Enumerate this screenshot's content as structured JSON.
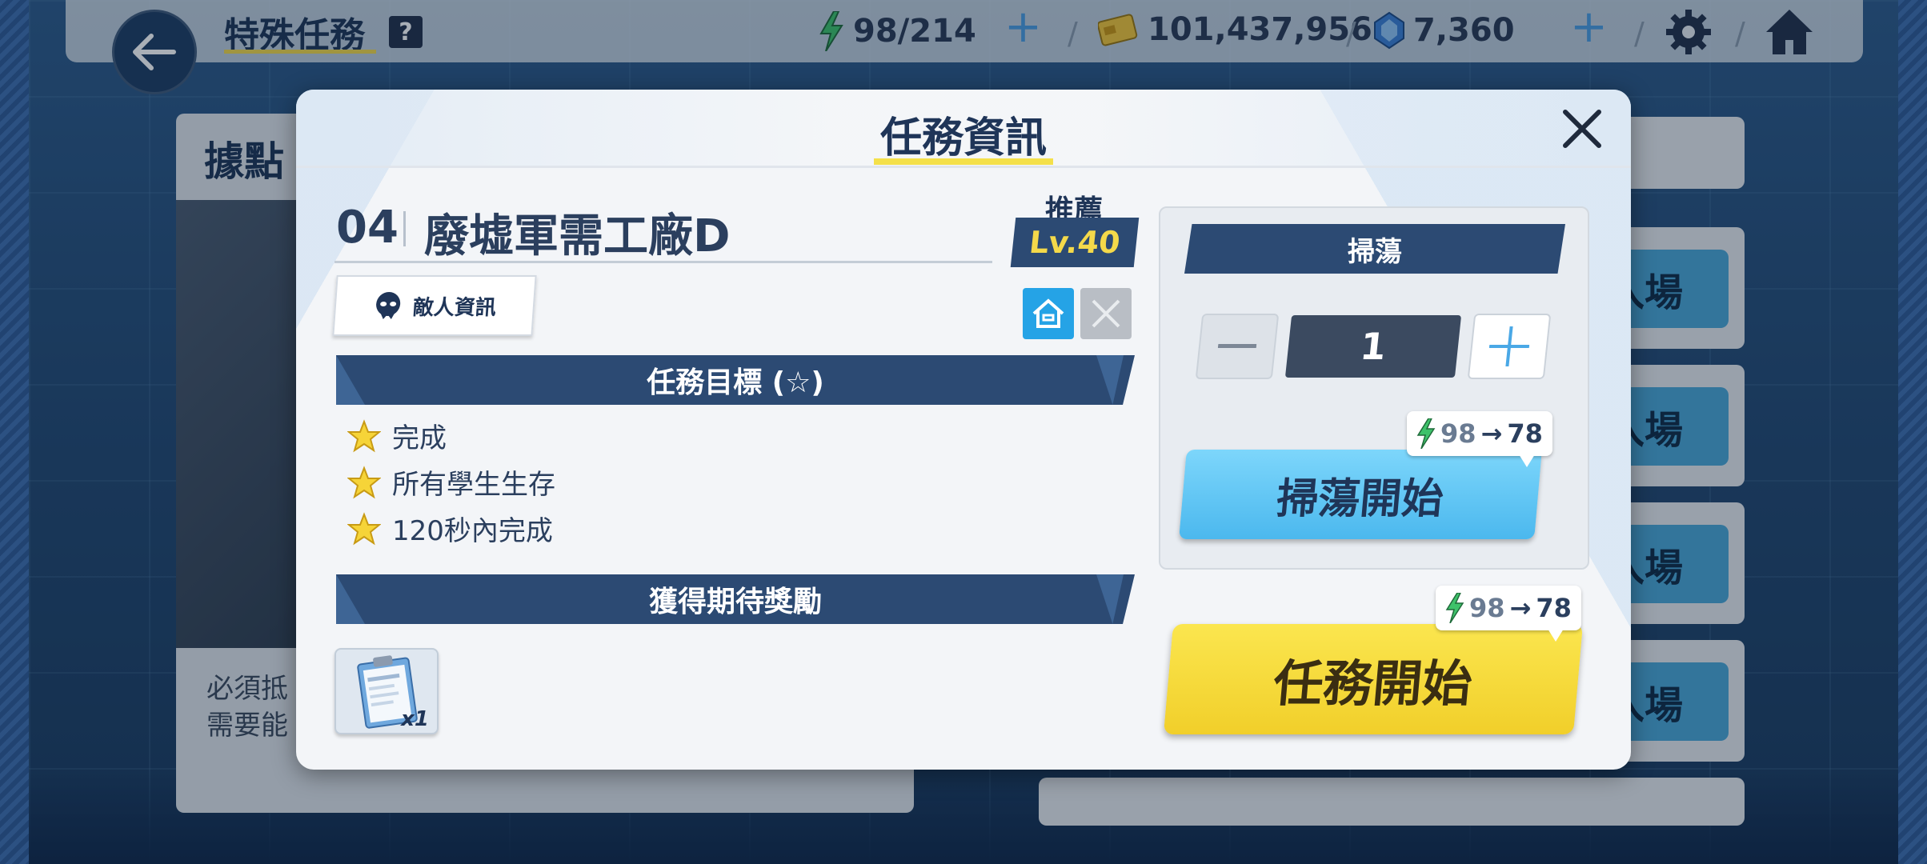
{
  "header": {
    "title": "特殊任務",
    "help": "?",
    "ap": "98/214",
    "credits": "101,437,956",
    "gems": "7,360"
  },
  "background": {
    "left_title": "據點",
    "left_text_line1": "必須抵",
    "left_text_line2": "需要能",
    "list_button_text": "入場",
    "list_items": [
      "入場",
      "入場",
      "入場",
      "入場"
    ]
  },
  "modal": {
    "title": "任務資訊",
    "stage_number": "04",
    "stage_name": "廢墟軍需工廠D",
    "recommend_label": "推薦",
    "recommend_level": "Lv.40",
    "enemy_info_label": "敵人資訊",
    "objectives_header": "任務目標 (☆)",
    "objectives": [
      "完成",
      "所有學生生存",
      "120秒內完成"
    ],
    "rewards_header": "獲得期待獎勵",
    "reward_quantity": "x1",
    "sweep": {
      "header": "掃蕩",
      "count": "1",
      "cost_from": "98",
      "cost_to": "78",
      "start_label": "掃蕩開始"
    },
    "start": {
      "cost_from": "98",
      "cost_to": "78",
      "label": "任務開始"
    }
  },
  "colors": {
    "navy": "#2c4a73",
    "accent_yellow": "#f4e04a",
    "sweep_blue": "#4bb8ee",
    "start_yellow": "#f1cf2a"
  }
}
